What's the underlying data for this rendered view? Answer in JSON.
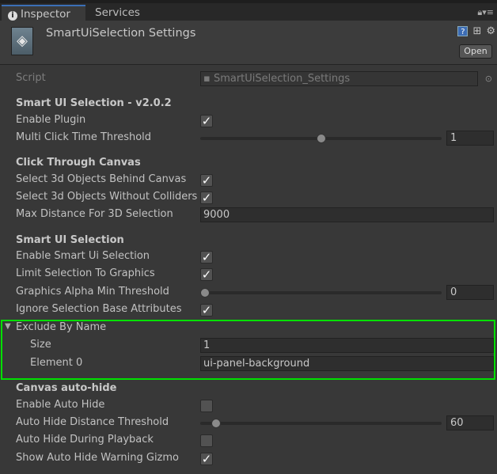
{
  "tabs": [
    {
      "label": "Inspector",
      "active": true
    },
    {
      "label": "Services",
      "active": false
    }
  ],
  "header": {
    "title": "SmartUiSelection Settings",
    "open_label": "Open",
    "icons": [
      "unity-logo-icon",
      "help-icon",
      "preset-icon",
      "gear-icon",
      "lock-icon",
      "menu-icon"
    ]
  },
  "script": {
    "label": "Script",
    "value": "SmartUiSelection_Settings"
  },
  "sections": {
    "s1": {
      "heading": "Smart UI Selection - v2.0.2",
      "enable_plugin": {
        "label": "Enable Plugin",
        "checked": true
      },
      "multi_click": {
        "label": "Multi Click Time Threshold",
        "value": "1",
        "slider_fraction": 0.5
      }
    },
    "s2": {
      "heading": "Click Through Canvas",
      "behind": {
        "label": "Select 3d Objects Behind Canvas",
        "checked": true
      },
      "without": {
        "label": "Select 3d Objects Without Colliders",
        "checked": true
      },
      "max_distance": {
        "label": "Max Distance For 3D Selection",
        "value": "9000"
      }
    },
    "s3": {
      "heading": "Smart UI Selection",
      "enable_smart": {
        "label": "Enable Smart Ui Selection",
        "checked": true
      },
      "limit": {
        "label": "Limit Selection To Graphics",
        "checked": true
      },
      "alpha": {
        "label": "Graphics Alpha Min Threshold",
        "value": "0",
        "slider_fraction": 0
      },
      "ignore": {
        "label": "Ignore Selection Base Attributes",
        "checked": true
      },
      "exclude": {
        "label": "Exclude By Name",
        "expanded": true,
        "size_label": "Size",
        "size": "1",
        "element_label": "Element 0",
        "element_value": "ui-panel-background"
      }
    },
    "s4": {
      "heading": "Canvas auto-hide",
      "enable_auto": {
        "label": "Enable Auto Hide",
        "checked": false
      },
      "distance": {
        "label": "Auto Hide Distance Threshold",
        "value": "60",
        "slider_fraction": 0.06
      },
      "playback": {
        "label": "Auto Hide During Playback",
        "checked": false
      },
      "warning": {
        "label": "Show Auto Hide Warning Gizmo",
        "checked": true
      }
    }
  },
  "colors": {
    "highlight": "#00e000",
    "tab_accent": "#3b6fb6"
  }
}
